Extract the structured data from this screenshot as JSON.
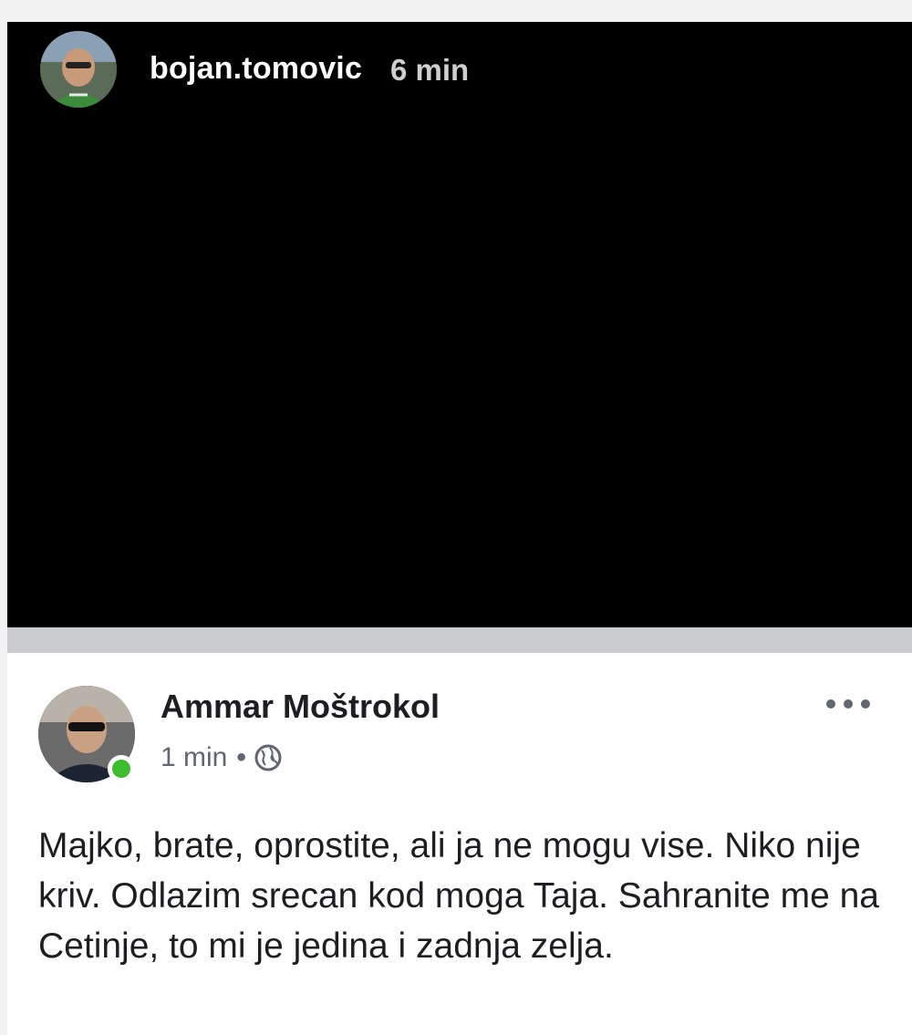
{
  "story": {
    "username": "bojan.tomovic",
    "time": "6 min"
  },
  "post": {
    "author": "Ammar Moštrokol",
    "time": "1 min",
    "separator": "•",
    "privacy_icon": "globe-icon",
    "online": true,
    "text": "Majko, brate, oprostite, ali ja ne mogu vise. Niko nije kriv. Odlazim srecan kod moga Taja. Sahranite me na Cetinje, to mi je jedina i zadnja zelja.",
    "more_icon": "more-options-icon"
  },
  "colors": {
    "story_background": "#000000",
    "online_indicator": "#3fbb2e",
    "card_background": "#ffffff",
    "meta_text": "#606770"
  }
}
